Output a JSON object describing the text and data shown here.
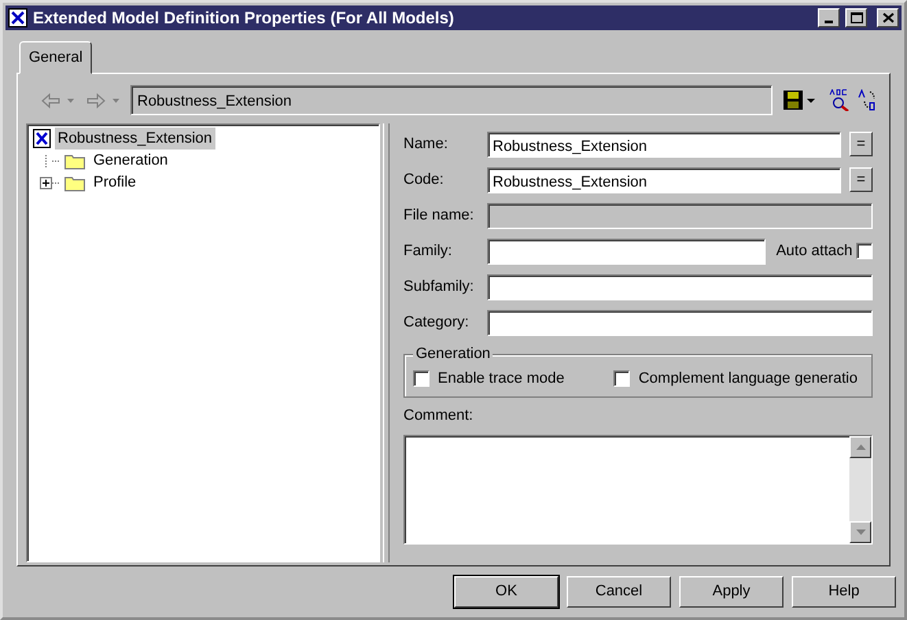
{
  "window": {
    "title": "Extended Model Definition Properties (For All Models)"
  },
  "tabs": [
    {
      "label": "General",
      "selected": true
    }
  ],
  "toolbar": {
    "path": "Robustness_Extension"
  },
  "tree": [
    {
      "label": "Robustness_Extension",
      "selected": true,
      "expandable": false,
      "children": [
        {
          "label": "Generation",
          "selected": false,
          "expandable": false
        },
        {
          "label": "Profile",
          "selected": false,
          "expandable": true
        }
      ]
    }
  ],
  "fields": [
    {
      "label": "Name:",
      "value": "Robustness_Extension",
      "disabled": false,
      "button": "="
    },
    {
      "label": "Code:",
      "value": "Robustness_Extension",
      "disabled": false,
      "button": "="
    },
    {
      "label": "File name:",
      "disabled": true
    },
    {
      "label": "Family:",
      "disabled": false,
      "checkbox": {
        "label": "Auto attach",
        "checked": false
      }
    },
    {
      "label": "Subfamily:",
      "disabled": false
    },
    {
      "label": "Category:",
      "disabled": false
    }
  ],
  "generation": {
    "title": "Generation",
    "options": [
      {
        "label": "Enable trace mode",
        "checked": false
      },
      {
        "label": "Complement language generatio",
        "checked": false
      }
    ]
  },
  "comment": {
    "label": "Comment:"
  },
  "buttons": [
    {
      "label": "OK",
      "default": true
    },
    {
      "label": "Cancel",
      "default": false
    },
    {
      "label": "Apply",
      "default": false
    },
    {
      "label": "Help",
      "default": false
    }
  ]
}
